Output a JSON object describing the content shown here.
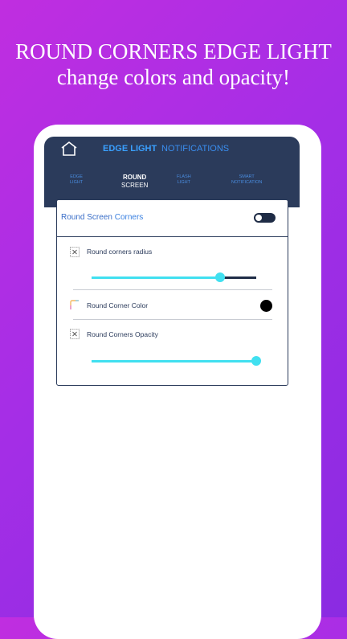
{
  "promo": {
    "line1": "ROUND CORNERS EDGE LIGHT",
    "line2": "change colors and opacity!"
  },
  "app": {
    "top_tabs": [
      {
        "label": "EDGE LIGHT",
        "active": true
      },
      {
        "label": "NOTIFICATIONS",
        "active": false
      }
    ],
    "sub_tabs": [
      {
        "line1": "EDGE",
        "line2": "LIGHT",
        "active": false
      },
      {
        "line1": "ROUND",
        "line2": "SCREEN",
        "active": true
      },
      {
        "line1": "FLASH",
        "line2": "LIGHT",
        "active": false
      },
      {
        "line1": "SMART",
        "line2": "NOTIFICATION",
        "active": false
      }
    ],
    "card": {
      "title_part1": "Round Screen",
      "title_part2": "Corners",
      "toggle_on": false,
      "rows": [
        {
          "label": "Round corners radius",
          "icon": "expand-corners-icon",
          "slider_value": 0.78
        },
        {
          "label": "Round Corner Color",
          "icon": "color-corner-icon",
          "color": "#000000"
        },
        {
          "label": "Round Corners Opacity",
          "icon": "expand-corners-icon",
          "slider_value": 1.0
        }
      ]
    }
  },
  "colors": {
    "navbar": "#2b3b5b",
    "accent": "#41e0f0",
    "active_tab": "#3aa0ff"
  }
}
